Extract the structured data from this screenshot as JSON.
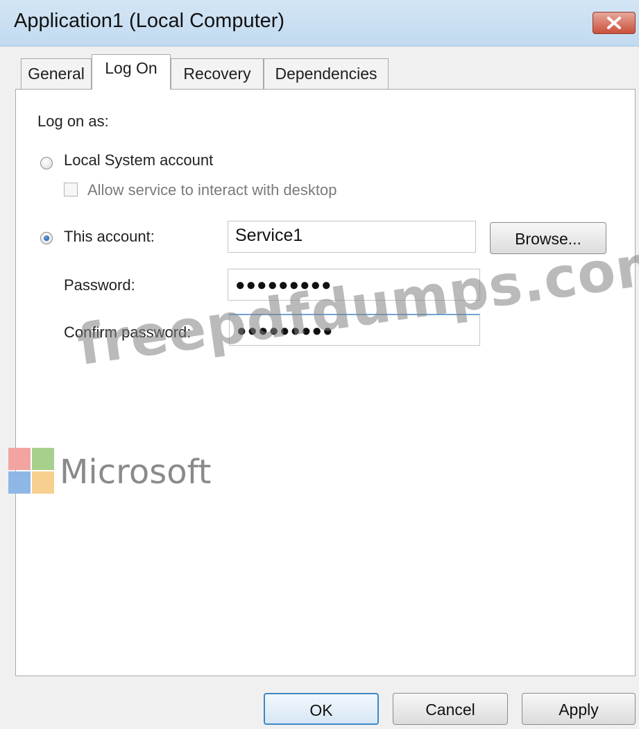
{
  "window": {
    "title": "Application1 (Local Computer)"
  },
  "tabs": [
    {
      "label": "General"
    },
    {
      "label": "Log On"
    },
    {
      "label": "Recovery"
    },
    {
      "label": "Dependencies"
    }
  ],
  "logon": {
    "heading": "Log on as:",
    "local_system": {
      "label": "Local System account",
      "selected": false
    },
    "interact_desktop": {
      "label": "Allow service to interact with desktop",
      "checked": false,
      "enabled": false
    },
    "this_account": {
      "label": "This account:",
      "selected": true,
      "value": "Service1"
    },
    "browse_label": "Browse...",
    "password": {
      "label": "Password:",
      "value": "●●●●●●●●●"
    },
    "confirm_password": {
      "label": "Confirm password:",
      "value": "●●●●●●●●●"
    }
  },
  "watermark": {
    "site": "freepdfdumps.com",
    "brand": "Microsoft"
  },
  "footer": {
    "ok": "OK",
    "cancel": "Cancel",
    "apply": "Apply"
  },
  "colors": {
    "titlebar": "#c8def2",
    "close": "#c9503b",
    "accent": "#3c87c8"
  }
}
